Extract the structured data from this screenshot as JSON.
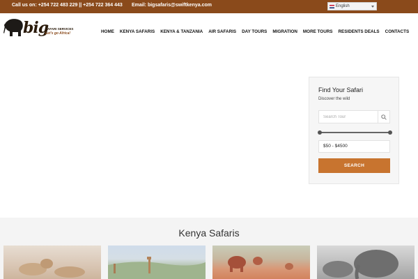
{
  "topbar": {
    "phone_text": "Call us on: +254 722 483 229 || +254 722 364 443",
    "email_text": "Email: bigsafaris@swiftkenya.com",
    "language": "English"
  },
  "logo": {
    "word": "big",
    "tagline_1": "SAFARI SERVICES",
    "tagline_2": "Let's go Africa!"
  },
  "nav": {
    "items": [
      "HOME",
      "KENYA SAFARIS",
      "KENYA & TANZANIA",
      "AIR SAFARIS",
      "DAY TOURS",
      "MIGRATION",
      "MORE TOURS",
      "RESIDENTS DEALS",
      "CONTACTS"
    ]
  },
  "finder": {
    "title": "Find Your Safari",
    "subtitle": "Discover the wild",
    "search_placeholder": "Search Tour",
    "price_range": "$50 - $4500",
    "submit_label": "SEARCH",
    "accent_color": "#c8742f"
  },
  "section": {
    "heading": "Kenya Safaris"
  },
  "colors": {
    "topbar": "#8a4a1b",
    "accent": "#c8742f"
  }
}
